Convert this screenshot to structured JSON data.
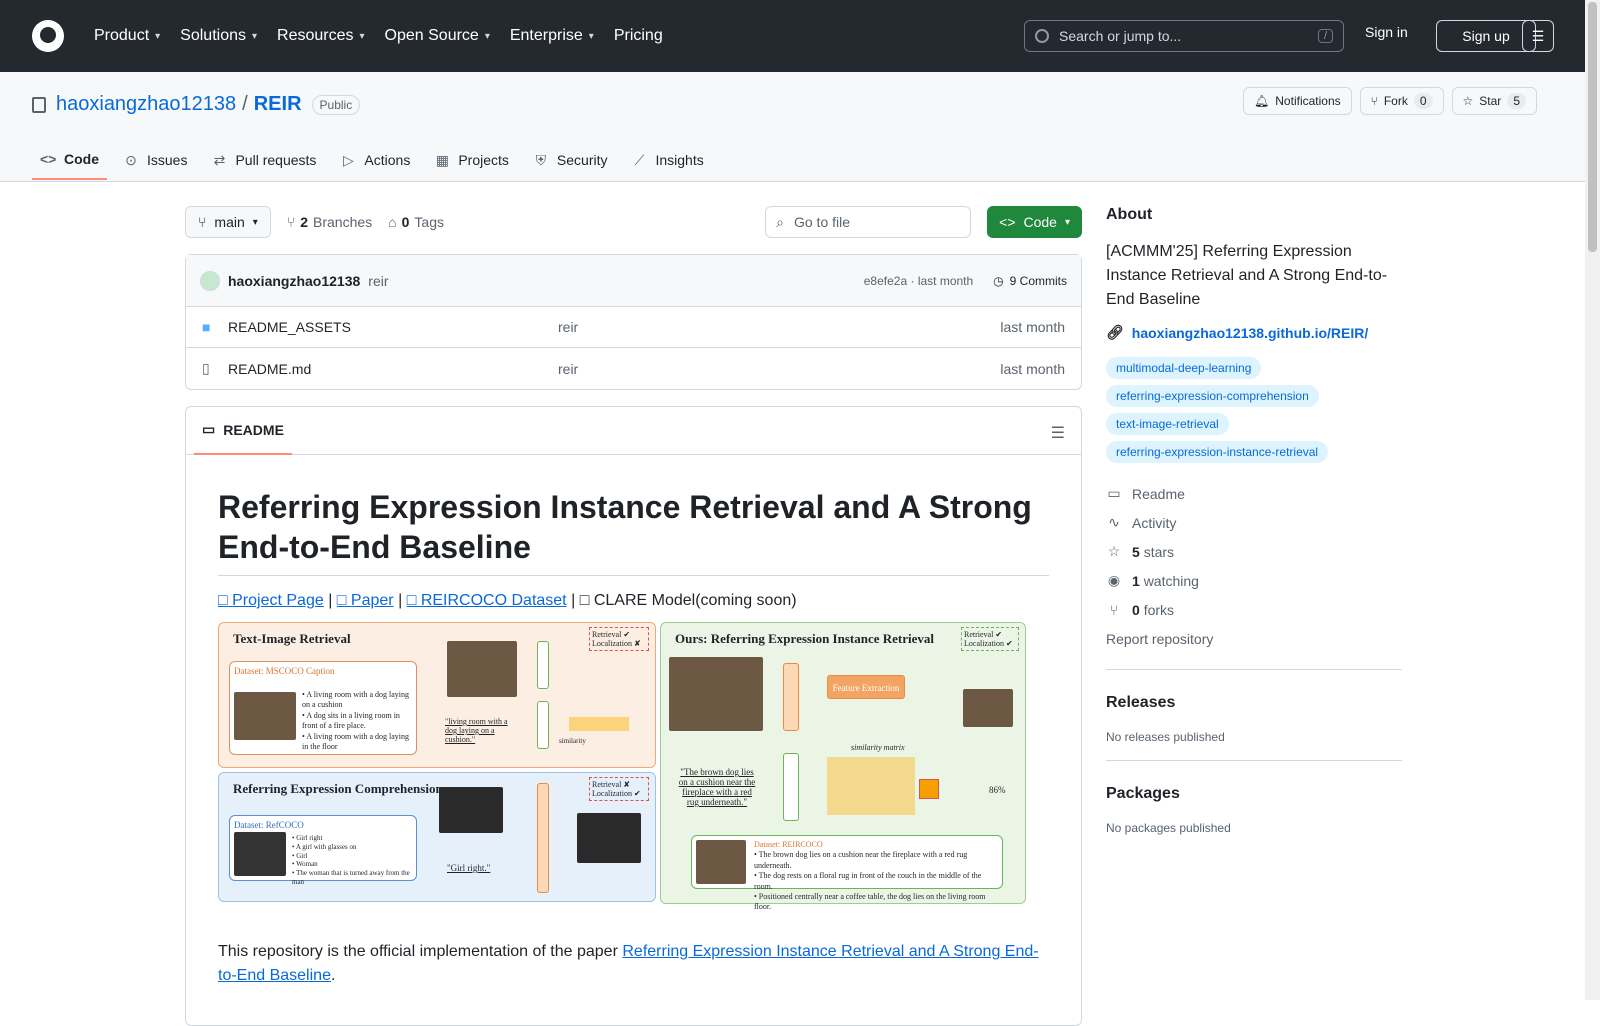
{
  "header": {
    "nav": [
      "Product",
      "Solutions",
      "Resources",
      "Open Source",
      "Enterprise",
      "Pricing"
    ],
    "search_placeholder": "Search or jump to...",
    "search_key": "/",
    "signin": "Sign in",
    "signup": "Sign up"
  },
  "repo": {
    "owner": "haoxiangzhao12138",
    "name": "REIR",
    "visibility": "Public",
    "notifications": "Notifications",
    "fork_label": "Fork",
    "fork_count": "0",
    "star_label": "Star",
    "star_count": "5"
  },
  "tabs": [
    {
      "label": "Code",
      "icon": "code-icon"
    },
    {
      "label": "Issues",
      "icon": "issue-icon"
    },
    {
      "label": "Pull requests",
      "icon": "pull-request-icon"
    },
    {
      "label": "Actions",
      "icon": "play-icon"
    },
    {
      "label": "Projects",
      "icon": "table-icon"
    },
    {
      "label": "Security",
      "icon": "shield-icon"
    },
    {
      "label": "Insights",
      "icon": "graph-icon"
    }
  ],
  "toolbar": {
    "branch": "main",
    "branches_count": "2",
    "branches_label": "Branches",
    "tags_count": "0",
    "tags_label": "Tags",
    "goto_placeholder": "Go to file",
    "code_btn": "Code"
  },
  "commit": {
    "author": "haoxiangzhao12138",
    "message": "reir",
    "hash": "e8efe2a",
    "sep": "·",
    "time": "last month",
    "commits": "9 Commits"
  },
  "files": [
    {
      "name": "README_ASSETS",
      "type": "folder",
      "message": "reir",
      "date": "last month"
    },
    {
      "name": "README.md",
      "type": "file",
      "message": "reir",
      "date": "last month"
    }
  ],
  "readme": {
    "tab": "README",
    "title": "Referring Expression Instance Retrieval and A Strong End-to-End Baseline",
    "links": [
      {
        "icon": "□",
        "text": "Project Page"
      },
      {
        "icon": "□",
        "text": "Paper"
      },
      {
        "icon": "□",
        "text": "REIRCOCO Dataset"
      }
    ],
    "link_sep": "|",
    "model_icon": "□",
    "model_text": "CLARE Model(coming soon)",
    "figure": {
      "p1_title": "Text-Image Retrieval",
      "p1_ds": "Dataset: MSCOCO Caption",
      "p1_status": "Retrieval ✔ Localization ✘",
      "p1_query": "\"living room with a dog laying on a cushion.\"",
      "p1_sim": "similarity",
      "p1_items": [
        "• A living room with a dog laying on a cushion",
        "• A dog sits in a living room in front of a fire place.",
        "• A living room with a dog laying in the floor"
      ],
      "p2_title": "Referring Expression Comprehension",
      "p2_ds": "Dataset: RefCOCO",
      "p2_status": "Retrieval ✘ Localization ✔",
      "p2_query": "\"Girl right.\"",
      "p2_items": [
        "• Girl right",
        "• A girl with glasses on",
        "• Girl",
        "• Woman",
        "• The woman that is turned away from the man"
      ],
      "p3_title": "Ours: Referring Expression Instance Retrieval",
      "p3_status": "Retrieval ✔ Localization ✔",
      "p3_feat": "Feature Extraction",
      "p3_matrix": "similarity matrix",
      "p3_query": "\"The brown dog lies on a cushion near the fireplace with a red rug underneath.\"",
      "p3_pct": "86%",
      "p3_ds": "Dataset: REIRCOCO",
      "p3_items": [
        "• The brown dog lies on a cushion near the fireplace with a red rug underneath.",
        "• The dog rests on a floral rug in front of the couch in the middle of the room.",
        "• Positioned centrally near a coffee table, the dog lies on the living room floor."
      ]
    },
    "desc_prefix": "This repository is the official implementation of the paper ",
    "desc_link": "Referring Expression Instance Retrieval and A Strong End-to-End Baseline",
    "desc_suffix": "."
  },
  "about": {
    "heading": "About",
    "text": "[ACMMM'25] Referring Expression Instance Retrieval and A Strong End-to-End Baseline",
    "homepage": "haoxiangzhao12138.github.io/REIR/",
    "topics": [
      "multimodal-deep-learning",
      "referring-expression-comprehension",
      "text-image-retrieval",
      "referring-expression-instance-retrieval"
    ],
    "readme": "Readme",
    "activity": "Activity",
    "stars_n": "5",
    "stars": "stars",
    "watching_n": "1",
    "watching": "watching",
    "forks_n": "0",
    "forks": "forks",
    "report": "Report repository"
  },
  "releases": {
    "heading": "Releases",
    "sub": "No releases published"
  },
  "packages": {
    "heading": "Packages",
    "sub": "No packages published"
  }
}
